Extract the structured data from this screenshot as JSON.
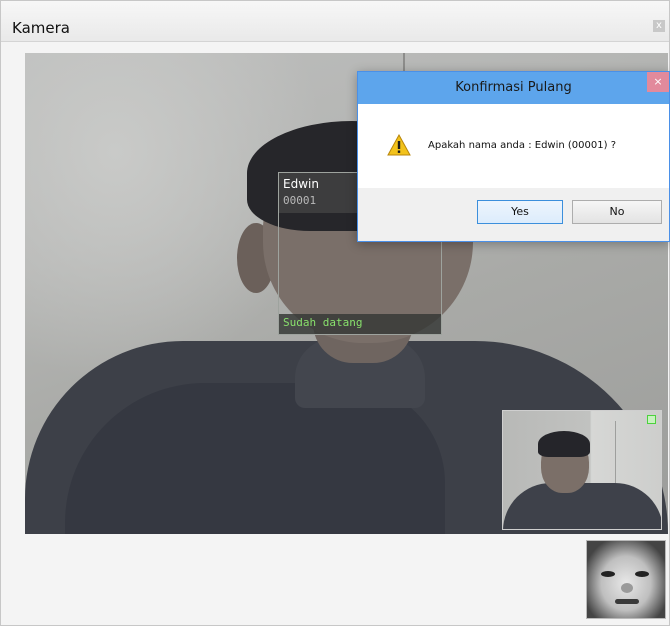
{
  "window": {
    "title": "Kamera",
    "close_symbol": "x"
  },
  "camera": {
    "detection": {
      "name": "Edwin",
      "id": "00001",
      "status": "Sudah datang",
      "status_color": "#88e06c"
    },
    "pip_indicator_color": "#4cd23d"
  },
  "dialog": {
    "title": "Konfirmasi Pulang",
    "close_symbol": "×",
    "icon": "warning-icon",
    "message": "Apakah nama anda : Edwin  (00001) ?",
    "yes_label": "Yes",
    "no_label": "No",
    "accent_color": "#5da5ec"
  }
}
